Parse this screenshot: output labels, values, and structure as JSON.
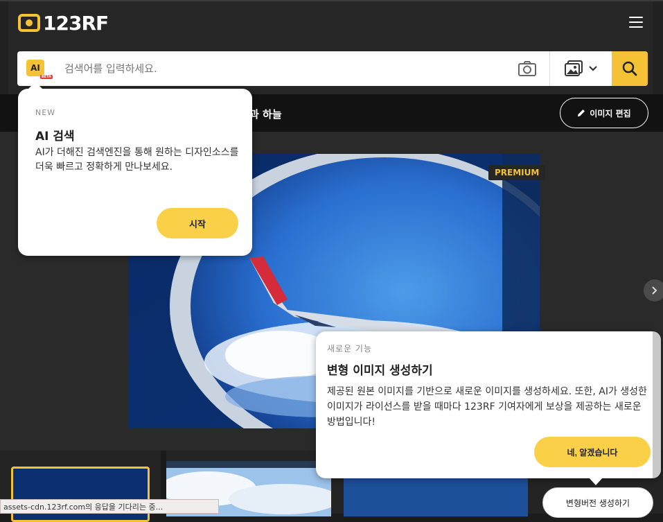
{
  "header": {
    "logo_text": "123RF",
    "menu_icon": "hamburger-icon"
  },
  "search": {
    "ai_badge": "AI",
    "ai_badge_tag": "BETA",
    "placeholder": "검색어를 입력하세요.",
    "camera_icon": "camera-icon",
    "image_type_icon": "image-icon",
    "search_icon": "search-icon"
  },
  "nav": {
    "partial_text": "과 하늘",
    "edit_button_label": "이미지 편집"
  },
  "image": {
    "badge": "PREMIUM"
  },
  "ai_tooltip": {
    "tag": "NEW",
    "title": "AI 검색",
    "description": "AI가 더해진 검색엔진을 통해 원하는 디자인소스를 더욱 빠르고 정확하게 만나보세요.",
    "button_label": "시작"
  },
  "variant_tooltip": {
    "tag": "새로운 기능",
    "title": "변형 이미지 생성하기",
    "description": "제공된 원본 이미지를 기반으로 새로운 이미지를 생성하세요. 또한, AI가 생성한 이미지가 라이선스를 받을 때마다 123RF 기여자에게 보상을 제공하는 새로운 방법입니다!",
    "button_label": "네, 알겠습니다"
  },
  "variant_button_label": "변형버전 생성하기",
  "status_bar": "assets-cdn.123rf.com의 응답을 기다리는 중...",
  "colors": {
    "accent": "#f5c235",
    "background": "#1c1c1c"
  }
}
